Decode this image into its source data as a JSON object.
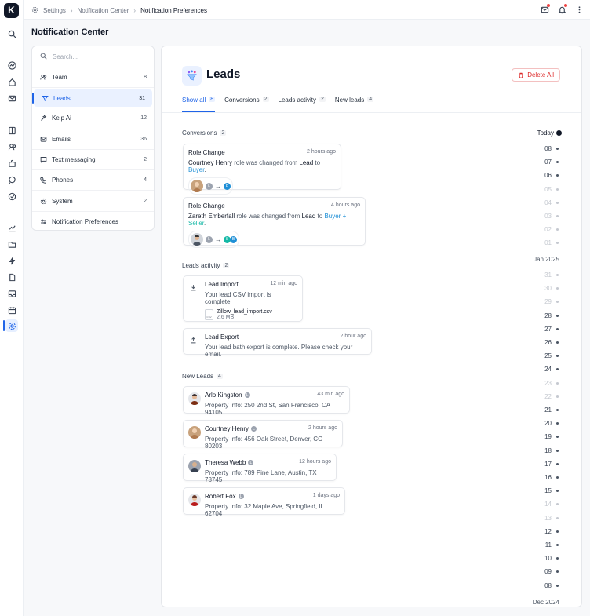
{
  "breadcrumb": {
    "root": "Settings",
    "middle": "Notification Center",
    "current": "Notification Preferences"
  },
  "page_title": "Notification Center",
  "sidebar": {
    "search_placeholder": "Search...",
    "items": [
      {
        "label": "Team",
        "count": "8",
        "icon": "team-icon"
      },
      {
        "label": "Leads",
        "count": "31",
        "icon": "leads-icon",
        "active": true
      },
      {
        "label": "Kelp Ai",
        "count": "12",
        "icon": "sparkle-icon"
      },
      {
        "label": "Emails",
        "count": "36",
        "icon": "mail-icon"
      },
      {
        "label": "Text messaging",
        "count": "2",
        "icon": "chat-icon"
      },
      {
        "label": "Phones",
        "count": "4",
        "icon": "phone-icon"
      },
      {
        "label": "System",
        "count": "2",
        "icon": "system-icon"
      },
      {
        "label": "Notification Preferences",
        "count": "",
        "icon": "preferences-icon"
      }
    ]
  },
  "header": {
    "title": "Leads",
    "delete_label": "Delete All"
  },
  "tabs": [
    {
      "label": "Show all",
      "count": "8",
      "active": true
    },
    {
      "label": "Conversions",
      "count": "2"
    },
    {
      "label": "Leads activity",
      "count": "2"
    },
    {
      "label": "New leads",
      "count": "4"
    }
  ],
  "sections": {
    "conversions": {
      "label": "Conversions",
      "count": "2"
    },
    "activity": {
      "label": "Leads activity",
      "count": "2"
    },
    "new_leads": {
      "label": "New Leads",
      "count": "4"
    }
  },
  "conversions": [
    {
      "title": "Role Change",
      "time": "2 hours ago",
      "name": "Courtney Henry",
      "mid": " role was changed from ",
      "from": "Lead",
      "to_word": " to ",
      "to": "Buyer",
      "to_end": "."
    },
    {
      "title": "Role Change",
      "time": "4 hours ago",
      "name": "Zareth Emberfall",
      "mid": " role was changed from ",
      "from": "Lead",
      "to_word": " to ",
      "to": "Buyer",
      "plus": " + ",
      "to2": "Seller",
      "to_end": "."
    }
  ],
  "activity": [
    {
      "title": "Lead Import",
      "time": "12 min ago",
      "desc": "Your lead CSV import is complete.",
      "file_name": "Zillow_lead_import.csv",
      "file_size": "2.6 MB",
      "file_ext": "CSV"
    },
    {
      "title": "Lead Export",
      "time": "2 hour ago",
      "desc": "Your lead bath export is complete. Please check your email."
    }
  ],
  "new_leads": [
    {
      "name": "Arlo Kingston",
      "time": "43 min ago",
      "info": "Property Info: 250 2nd St, San Francisco, CA 94105"
    },
    {
      "name": "Courtney Henry",
      "time": "2 hours ago",
      "info": "Property Info: 456 Oak Street, Denver, CO 80203"
    },
    {
      "name": "Theresa Webb",
      "time": "12 hours ago",
      "info": "Property Info: 789 Pine Lane, Austin, TX 78745"
    },
    {
      "name": "Robert Fox",
      "time": "1 days ago",
      "info": "Property Info: 32 Maple Ave, Springfield, IL 62704"
    }
  ],
  "timeline": {
    "today": "Today",
    "jan_days": [
      "08",
      "07",
      "06",
      "05",
      "04",
      "03",
      "02",
      "01"
    ],
    "jan_dim": [
      false,
      false,
      false,
      true,
      true,
      true,
      true,
      true
    ],
    "month1": "Jan 2025",
    "dec_days": [
      "31",
      "30",
      "29",
      "28",
      "27",
      "26",
      "25",
      "24",
      "23",
      "22",
      "21",
      "20",
      "19",
      "18",
      "17",
      "16",
      "15",
      "14",
      "13",
      "12",
      "11",
      "10",
      "09",
      "08"
    ],
    "dec_dim": [
      true,
      true,
      true,
      false,
      false,
      false,
      false,
      false,
      true,
      true,
      false,
      false,
      false,
      false,
      false,
      false,
      false,
      true,
      true,
      false,
      false,
      false,
      false,
      false
    ],
    "month2": "Dec 2024"
  },
  "colors": {
    "accent": "#1f64e8",
    "danger": "#dc2626",
    "buyer": "#1f8fd6",
    "seller": "#14b8a6"
  }
}
